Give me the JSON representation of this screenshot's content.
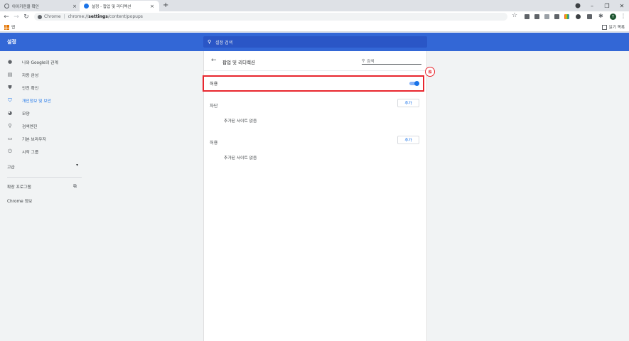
{
  "tabs": [
    {
      "title": "아이키린을 확인",
      "icon": "globe-icon",
      "active": false
    },
    {
      "title": "설정 - 팝업 및 리디렉션",
      "icon": "gear-icon",
      "active": true
    }
  ],
  "new_tab_symbol": "+",
  "close_symbol": "×",
  "window_controls": {
    "minimize": "–",
    "maximize": "❐",
    "close": "✕"
  },
  "address": {
    "scheme_label": "Chrome",
    "url_prefix": "chrome://",
    "url_bold": "settings",
    "url_suffix": "/content/popups"
  },
  "profile_initial": "Y",
  "bookmarks": {
    "apps_label": "앱",
    "reading_list_label": "읽기 목록"
  },
  "header": {
    "title": "설정",
    "search_placeholder": "설정 검색",
    "bg_color": "#3367d6"
  },
  "sidebar": {
    "items": [
      {
        "label": "나와 Google의 관계",
        "icon": "person-icon"
      },
      {
        "label": "자동 완성",
        "icon": "clipboard-icon"
      },
      {
        "label": "안전 확인",
        "icon": "shield-icon"
      },
      {
        "label": "개인정보 및 보안",
        "icon": "shield-lock-icon",
        "selected": true
      },
      {
        "label": "모양",
        "icon": "palette-icon"
      },
      {
        "label": "검색엔진",
        "icon": "search-icon"
      },
      {
        "label": "기본 브라우저",
        "icon": "browser-icon"
      },
      {
        "label": "시작 그룹",
        "icon": "power-icon"
      }
    ],
    "advanced_label": "고급",
    "extensions_label": "확장 프로그램",
    "about_label": "Chrome 정보"
  },
  "page": {
    "title": "팝업 및 리디렉션",
    "search_placeholder": "검색",
    "allow_toggle_label": "허용",
    "allow_toggle_on": true,
    "block_section": {
      "label": "차단",
      "add_button": "추가",
      "empty_text": "추가된 사이트 없음"
    },
    "allow_section": {
      "label": "허용",
      "add_button": "추가",
      "empty_text": "추가된 사이트 없음"
    }
  },
  "annotation": {
    "marker": "⑤",
    "color": "#e8262e"
  },
  "accent_color": "#1a73e8"
}
